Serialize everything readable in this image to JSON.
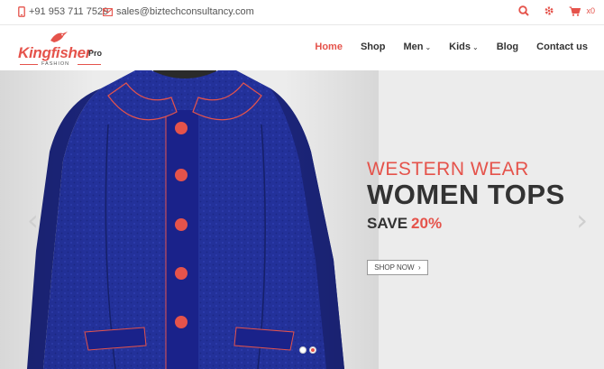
{
  "topbar": {
    "phone": "+91 953 711 7529",
    "email": "sales@biztechconsultancy.com",
    "cart_count": "x0"
  },
  "logo": {
    "name": "Kingfisher",
    "suffix": "Pro",
    "tagline": "FASHION"
  },
  "nav": {
    "items": [
      {
        "label": "Home",
        "active": true
      },
      {
        "label": "Shop"
      },
      {
        "label": "Men",
        "dropdown": true
      },
      {
        "label": "Kids",
        "dropdown": true
      },
      {
        "label": "Blog"
      },
      {
        "label": "Contact us"
      }
    ]
  },
  "slider": {
    "subtitle": "WESTERN WEAR",
    "title": "WOMEN TOPS",
    "save_text": "SAVE",
    "save_percent": "20%",
    "button_label": "SHOP NOW",
    "button_arrow": "›",
    "prev": "‹",
    "next": "›",
    "active_slide": 2
  },
  "colors": {
    "accent": "#e5534b",
    "text": "#333333",
    "jacket": "#1e2a8c"
  },
  "icons": [
    "phone-icon",
    "mail-icon",
    "search-icon",
    "gear-icon",
    "cart-icon"
  ]
}
